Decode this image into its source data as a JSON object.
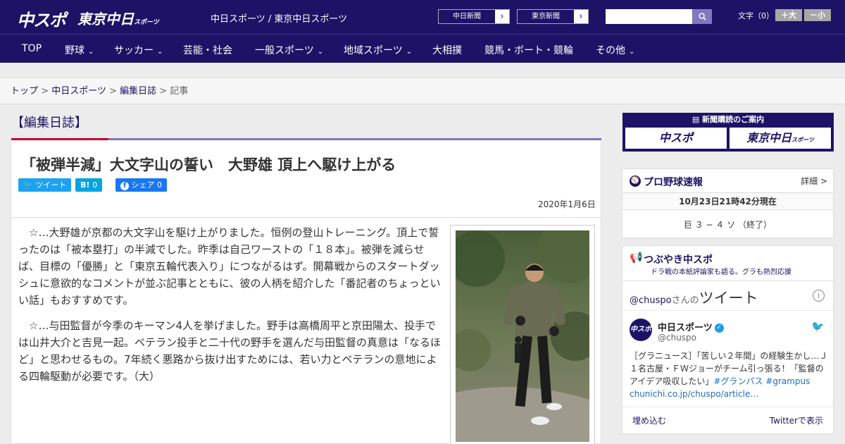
{
  "header": {
    "logo_chuspo": "中スポ",
    "logo_tokyo": "東京中日",
    "logo_tokyo_small": "スポーツ",
    "site_names": "中日スポーツ / 東京中日スポーツ",
    "ext_links": [
      {
        "label": "中日新聞",
        "arrow": "›"
      },
      {
        "label": "東京新聞",
        "arrow": "›"
      }
    ],
    "search_placeholder": "",
    "font_size_label": "文字（0）",
    "font_larger": "＋大",
    "font_smaller": "－小"
  },
  "nav": {
    "items": [
      {
        "label": "TOP",
        "has_dropdown": false
      },
      {
        "label": "野球",
        "has_dropdown": true
      },
      {
        "label": "サッカー",
        "has_dropdown": true
      },
      {
        "label": "芸能・社会",
        "has_dropdown": false
      },
      {
        "label": "一般スポーツ",
        "has_dropdown": true
      },
      {
        "label": "地域スポーツ",
        "has_dropdown": true
      },
      {
        "label": "大相撲",
        "has_dropdown": false
      },
      {
        "label": "競馬・ボート・競輪",
        "has_dropdown": false
      },
      {
        "label": "その他",
        "has_dropdown": true
      }
    ],
    "chevron": "⌄"
  },
  "breadcrumb": {
    "items": [
      "トップ",
      "中日スポーツ",
      "編集日誌",
      "記事"
    ],
    "separator": " > "
  },
  "article": {
    "category": "【編集日誌】",
    "title": "「被弾半減」大文字山の誓い　大野雄 頂上へ駆け上がる",
    "share": {
      "tweet": "ツイート",
      "hatena": "B!",
      "hatena_count": "0",
      "facebook": "シェア",
      "facebook_count": "0"
    },
    "date": "2020年1月6日",
    "paragraphs": [
      "　☆…大野雄が京都の大文字山を駆け上がりました。恒例の登山トレーニング。頂上で誓ったのは「被本塁打」の半減でした。昨季は自己ワーストの「１８本」。被弾を減らせば、目標の「優勝」と「東京五輪代表入り」につながるはず。開幕戦からのスタートダッシュに意欲的なコメントが並ぶ記事とともに、彼の人柄を紹介した「番記者のちょっといい話」もおすすめです。",
      "　☆…与田監督が今季のキーマン4人を挙げました。野手は高橋周平と京田陽太、投手では山井大介と吉見一起。ベテラン投手と二十代の野手を選んだ与田監督の真意は「なるほど」と思わせるもの。7年続く悪路から抜け出すためには、若い力とベテランの意地による四輪駆動が必要です。（大）"
    ]
  },
  "sidebar": {
    "subscribe": {
      "header": "新聞購読のご案内",
      "left": "中スポ",
      "right": "東京中日",
      "right_small": "スポーツ"
    },
    "baseball": {
      "title": "プロ野球速報",
      "more": "詳細 >",
      "updated": "10月23日21時42分現在",
      "score": "巨 ３ − ４ ソ （終了）"
    },
    "twitter": {
      "title": "つぶやき中スポ",
      "subtitle": "ドラ戦の本紙評論家も語る。グラも熱烈応援",
      "handle_link": "@chuspo",
      "handle_suffix": "さんの",
      "tweets_label": "ツイート",
      "info": "i",
      "account_name": "中日スポーツ",
      "verified": "✓",
      "account_handle": "@chuspo",
      "avatar": "中スポ",
      "tweet_text": "［グラニュース］「苦しい２年間」の経験生かし…Ｊ１名古屋・ＦＷジョーがチーム引っ張る！「監督のアイデア吸収したい」",
      "hashtags": "#グランパス #grampus",
      "link": "chunichi.co.jp/chuspo/article…",
      "embed": "埋め込む",
      "view_on_twitter": "Twitterで表示"
    }
  },
  "colors": {
    "brand_navy": "#1d1366",
    "accent_red": "#c8002d",
    "twitter_blue": "#1da1f2",
    "hatena_blue": "#00a4de",
    "facebook_blue": "#1877f2"
  }
}
